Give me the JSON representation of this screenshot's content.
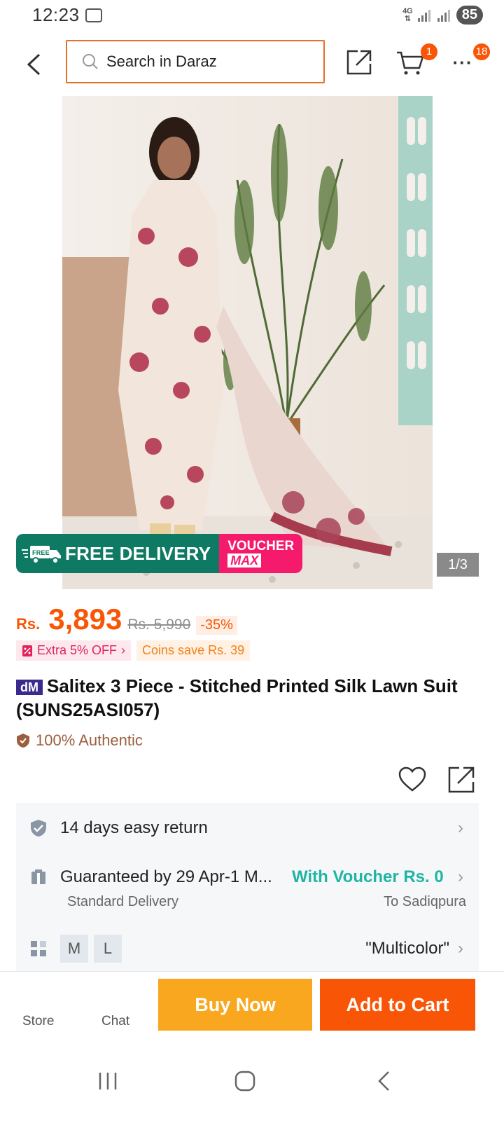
{
  "status": {
    "time": "12:23",
    "network": "4G",
    "battery": "85"
  },
  "header": {
    "search_placeholder": "Search in Daraz",
    "cart_badge": "1",
    "more_badge": "18"
  },
  "gallery": {
    "counter": "1/3",
    "promo_free": "FREE DELIVERY",
    "promo_free_tag": "FREE",
    "promo_voucher_line1": "VOUCHER",
    "promo_voucher_line2": "MAX"
  },
  "price": {
    "currency": "Rs.",
    "current": "3,893",
    "original": "Rs. 5,990",
    "discount": "-35%"
  },
  "chips": {
    "extra": "Extra 5% OFF",
    "coins": "Coins save Rs. 39"
  },
  "product": {
    "brand_tag": "dM",
    "title": "Salitex 3 Piece - Stitched Printed Silk Lawn Suit (SUNS25ASI057)",
    "authentic": "100% Authentic"
  },
  "info": {
    "returns": "14 days easy return",
    "delivery": "Guaranteed by 29 Apr-1 M...",
    "voucher": "With Voucher Rs. 0",
    "delivery_type": "Standard Delivery",
    "delivery_to": "To Sadiqpura",
    "sizes": [
      "M",
      "L"
    ],
    "color": "\"Multicolor\""
  },
  "bottom": {
    "store": "Store",
    "chat": "Chat",
    "buy_now": "Buy Now",
    "add_to_cart": "Add to Cart"
  },
  "colors": {
    "accent": "#f85606",
    "buy": "#f9a71f",
    "teal": "#1fb5a4",
    "promo_green": "#0f7a63",
    "promo_pink": "#f51a6b"
  }
}
